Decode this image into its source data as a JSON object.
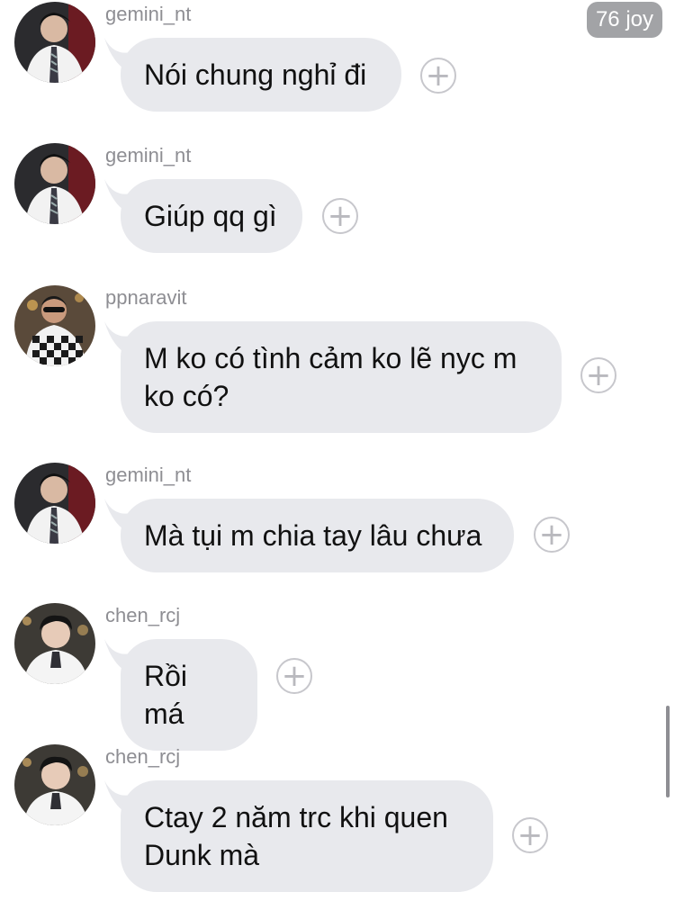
{
  "reaction_badge": "76 joy",
  "add_reaction_symbol": "+",
  "messages": [
    {
      "user": "gemini_nt",
      "avatar": "avatar-gemini-icon",
      "text": "Nói chung nghỉ đi"
    },
    {
      "user": "gemini_nt",
      "avatar": "avatar-gemini-icon",
      "text": "Giúp qq gì"
    },
    {
      "user": "ppnaravit",
      "avatar": "avatar-ppnaravit-icon",
      "text": "M ko có tình cảm ko lẽ nyc m\nko có?"
    },
    {
      "user": "gemini_nt",
      "avatar": "avatar-gemini-icon",
      "text": "Mà tụi m chia tay lâu chưa"
    },
    {
      "user": "chen_rcj",
      "avatar": "avatar-chen-icon",
      "text": "Rồi má"
    },
    {
      "user": "chen_rcj",
      "avatar": "avatar-chen-icon",
      "text": "Ctay 2 năm trc khi quen\nDunk mà"
    }
  ],
  "colors": {
    "bubble": "#e8e9ed",
    "username": "#8e8e93",
    "badge": "#a2a3a6"
  }
}
